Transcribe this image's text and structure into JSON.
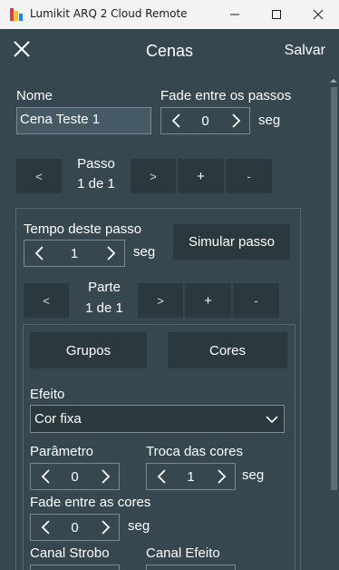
{
  "window": {
    "title": "Lumikit ARQ 2 Cloud Remote"
  },
  "header": {
    "title": "Cenas",
    "save_label": "Salvar"
  },
  "scene": {
    "name_label": "Nome",
    "name_value": "Cena Teste 1",
    "fade_label": "Fade entre os passos",
    "fade_value": "0",
    "fade_unit": "seg"
  },
  "step_nav": {
    "prev": "<",
    "title": "Passo",
    "counter": "1 de 1",
    "next": ">",
    "add": "+",
    "remove": "-"
  },
  "step": {
    "time_label": "Tempo deste passo",
    "time_value": "1",
    "time_unit": "seg",
    "simulate_label": "Simular passo"
  },
  "part_nav": {
    "prev": "<",
    "title": "Parte",
    "counter": "1 de 1",
    "next": ">",
    "add": "+",
    "remove": "-"
  },
  "part": {
    "groups_label": "Grupos",
    "colors_label": "Cores",
    "effect_label": "Efeito",
    "effect_value": "Cor fixa",
    "param_label": "Parâmetro",
    "param_value": "0",
    "color_swap_label": "Troca das cores",
    "color_swap_value": "1",
    "color_swap_unit": "seg",
    "color_fade_label": "Fade entre as cores",
    "color_fade_value": "0",
    "color_fade_unit": "seg",
    "strobe_label": "Canal Strobo",
    "effect_channel_label": "Canal Efeito"
  }
}
